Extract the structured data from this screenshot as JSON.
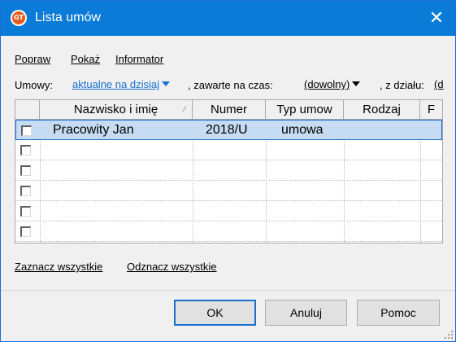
{
  "window": {
    "title": "Lista umów",
    "app_icon_text": "GT",
    "close_glyph": "✕"
  },
  "menu": [
    "Popraw",
    "Pokaż",
    "Informator"
  ],
  "filter": {
    "label_umowy": "Umowy:",
    "umowy_value": "aktualne na dzisiaj",
    "label_zawarte": ", zawarte na czas:",
    "zawarte_value": "(dowolny)",
    "label_dzial": ", z działu:",
    "dzial_value": "(d",
    "link_color": "#1a6fd0"
  },
  "table": {
    "columns": [
      "",
      "Nazwisko i imię",
      "Numer",
      "Typ umow",
      "Rodzaj",
      "F"
    ],
    "sort_indicator": "∕",
    "rows": [
      {
        "selected": true,
        "nazwisko": "Pracowity Jan",
        "numer": "2018/U",
        "typ": "umowa",
        "rodzaj": ""
      },
      {
        "selected": false,
        "nazwisko": "",
        "numer": "",
        "typ": "",
        "rodzaj": ""
      },
      {
        "selected": false,
        "nazwisko": "",
        "numer": "",
        "typ": "",
        "rodzaj": ""
      },
      {
        "selected": false,
        "nazwisko": "",
        "numer": "",
        "typ": "",
        "rodzaj": ""
      },
      {
        "selected": false,
        "nazwisko": "",
        "numer": "",
        "typ": "",
        "rodzaj": ""
      },
      {
        "selected": false,
        "nazwisko": "",
        "numer": "",
        "typ": "",
        "rodzaj": ""
      }
    ]
  },
  "links": {
    "select_all": "Zaznacz wszystkie",
    "deselect_all": "Odznacz wszystkie"
  },
  "buttons": {
    "ok": "OK",
    "cancel": "Anuluj",
    "help": "Pomoc"
  },
  "colors": {
    "titlebar": "#0a7bd6",
    "selection": "#c5dcf2",
    "selection_border": "#1e6bd0",
    "default_button_border": "#1a6fd0"
  }
}
